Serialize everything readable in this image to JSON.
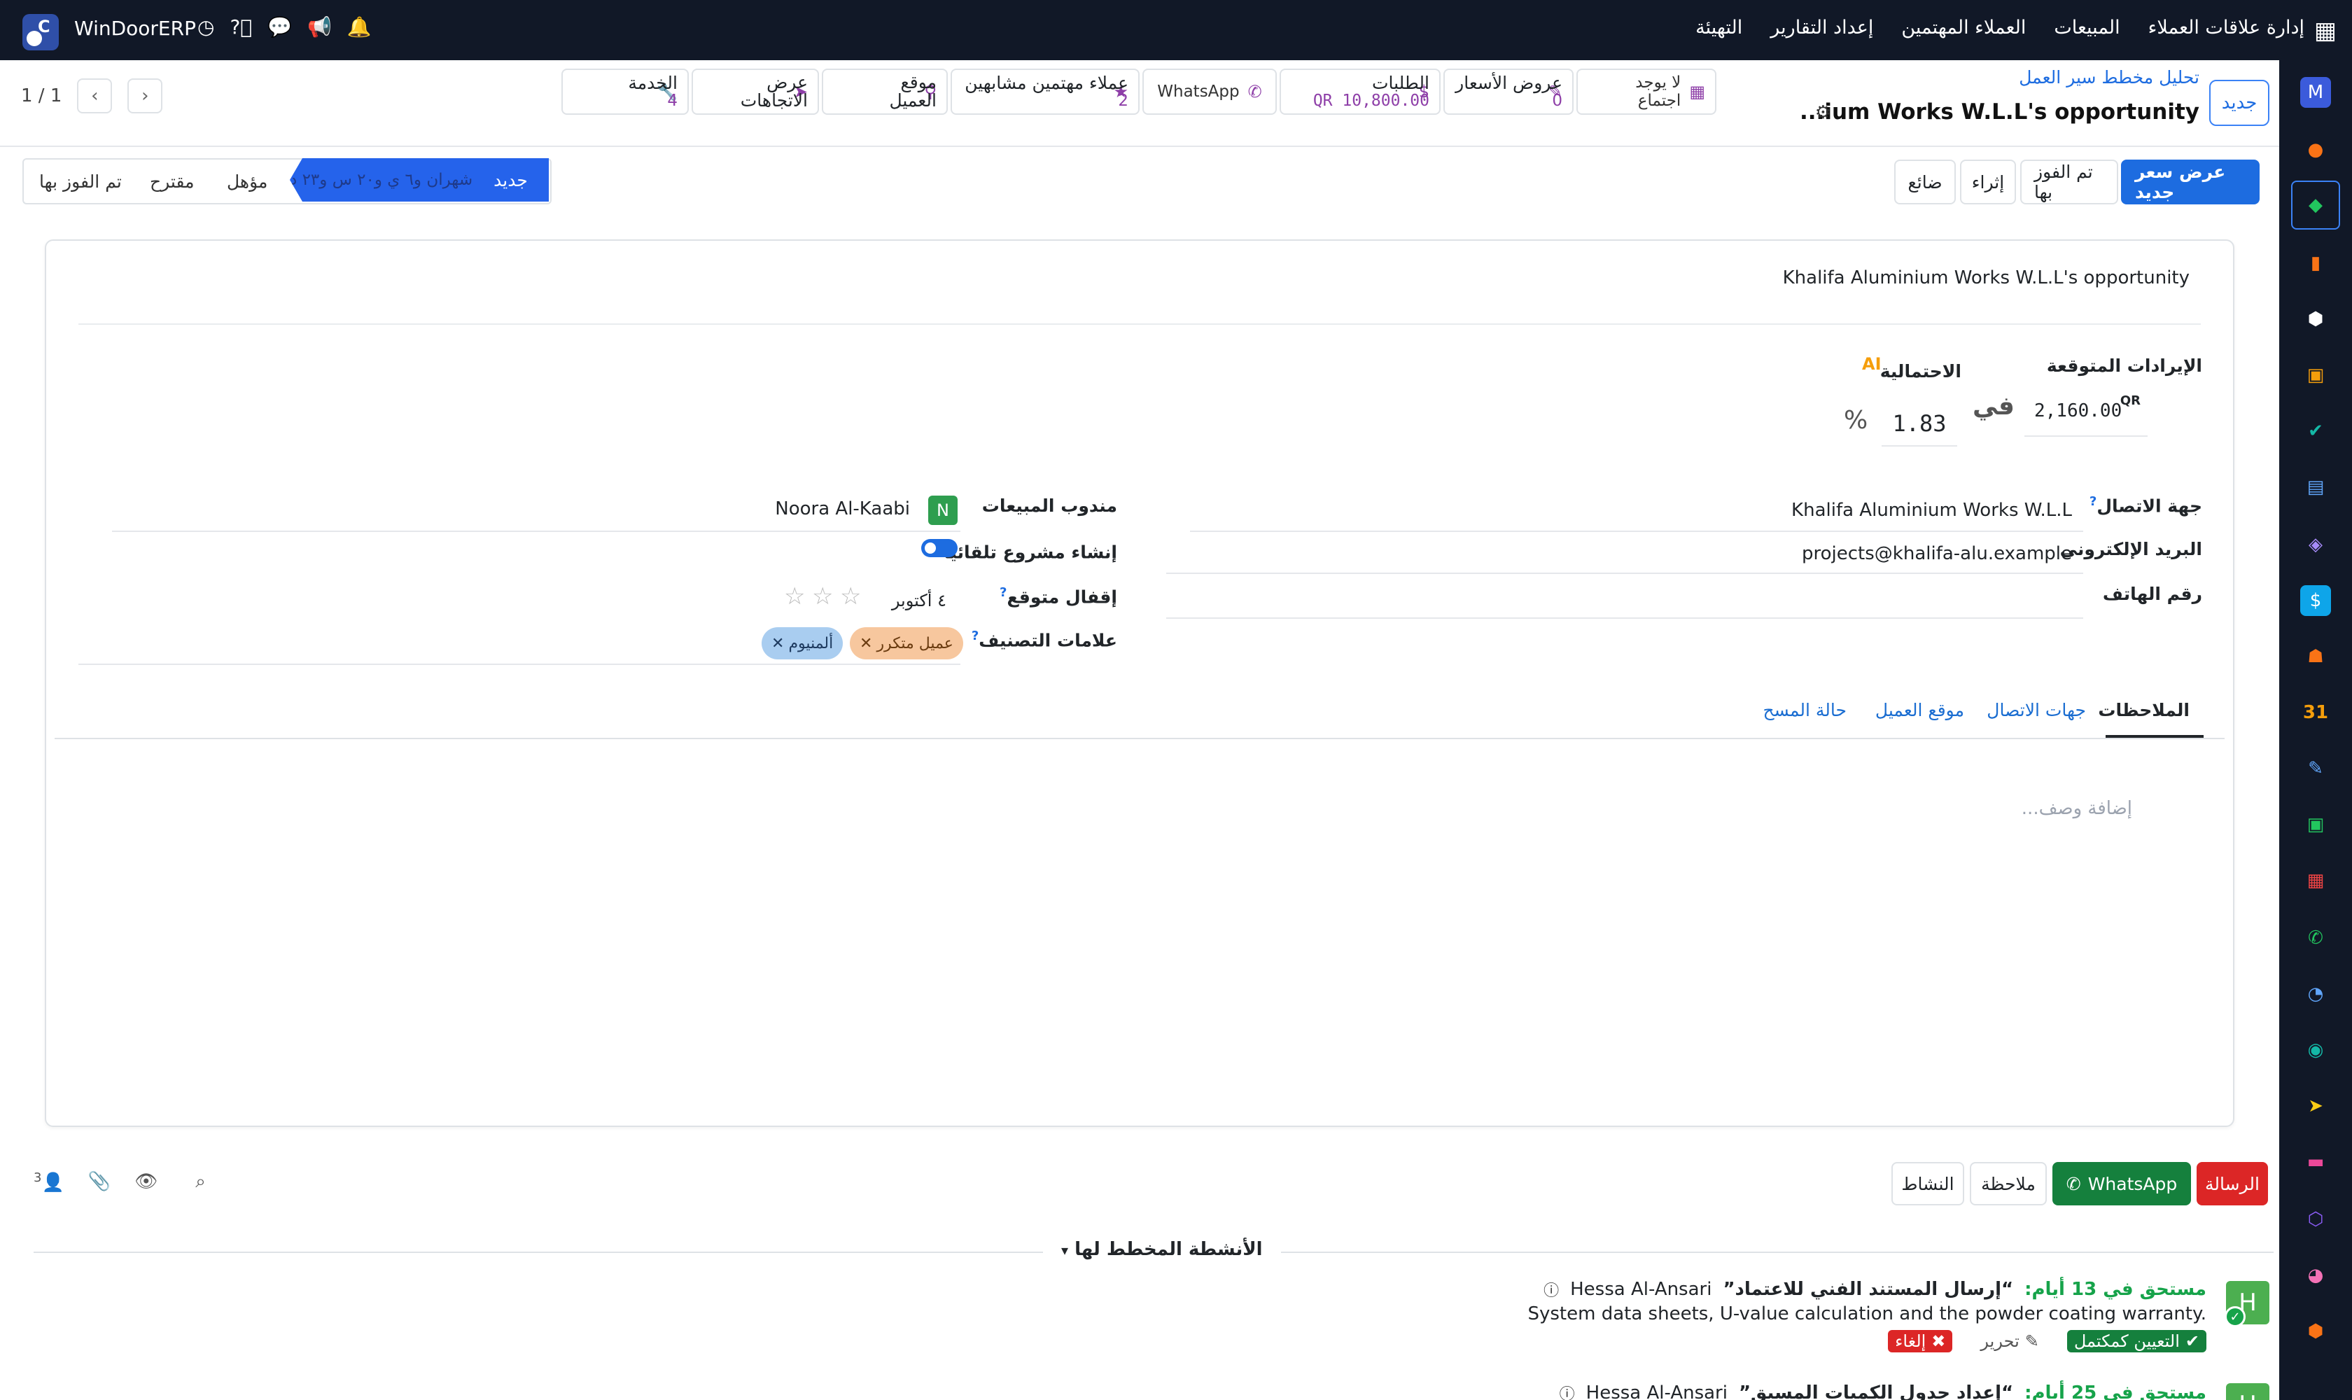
{
  "topbar": {
    "brand": "WinDoorERP",
    "menu": [
      "إدارة علاقات العملاء",
      "المبيعات",
      "العملاء المهتمين",
      "إعداد التقارير",
      "التهيئة"
    ]
  },
  "pager": {
    "text": "1 / 1"
  },
  "breadcrumb": "تحليل مخطط سير العمل",
  "record_title": "...ium Works W.L.L's opportunity",
  "new_label": "جديد",
  "smart_buttons": {
    "meeting": "لا يوجد اجتماع",
    "quotes_label": "عروض الأسعار",
    "quotes_count": "0",
    "orders_label": "الطلبات",
    "orders_amount": "10,800.00 QR",
    "whatsapp": "WhatsApp",
    "similar_label": "عملاء مهتمين مشابهين",
    "similar_count": "2",
    "location_l1": "موقع",
    "location_l2": "العميل",
    "directions_l1": "عرض",
    "directions_l2": "الاتجاهات",
    "service_label": "الخدمة",
    "service_count": "4"
  },
  "actions": {
    "new_quote": "عرض سعر جديد",
    "won": "تم الفوز بها",
    "enrich": "إثراء",
    "lost": "ضائع"
  },
  "stages": {
    "current": "جديد",
    "current_sub": "شهران و٦ ي و٢٠ س و٢٣ د",
    "qualified": "مؤهل",
    "proposition": "مقترح",
    "won": "تم الفوز بها"
  },
  "form": {
    "opportunity_name": "Khalifa Aluminium Works W.L.L's opportunity",
    "expected_revenue_label": "الإيرادات المتوقعة",
    "expected_revenue": "2,160.00",
    "currency": "QR",
    "at_label": "في",
    "probability_label": "الاحتمالية",
    "probability": "1.83",
    "percent": "%",
    "contact_label": "جهة الاتصال",
    "contact_value": "Khalifa Aluminium Works W.L.L",
    "email_label": "البريد الإلكتروني",
    "email_value": "projects@khalifa-alu.example",
    "phone_label": "رقم الهاتف",
    "salesperson_label": "مندوب المبيعات",
    "salesperson_initial": "N",
    "salesperson_value": "Noora Al-Kaabi",
    "auto_project_label": "إنشاء مشروع تلقائياً",
    "expected_close_label": "إقفال متوقع",
    "expected_close_value": "٤ أكتوبر",
    "tags_label": "علامات التصنيف",
    "tags": [
      "عميل متكرر",
      "ألمنيوم"
    ]
  },
  "tabs": [
    "الملاحظات",
    "جهات الاتصال",
    "موقع العميل",
    "حالة المسح"
  ],
  "notes_placeholder": "إضافة وصف...",
  "chatter": {
    "message": "الرسالة",
    "whatsapp": "WhatsApp",
    "note": "ملاحظة",
    "activity": "النشاط",
    "followers_count": "3",
    "planned_title": "الأنشطة المخطط لها"
  },
  "activities": [
    {
      "initial": "H",
      "due": "مستحق في 13 أيام:",
      "title": "“إرسال المستند الفني للاعتماد”",
      "who": "Hessa Al-Ansari",
      "desc": "System data sheets, U-value calculation and the powder coating warranty.",
      "mark_done": "التعيين كمكتمل",
      "edit": "تحرير",
      "cancel": "إلغاء"
    },
    {
      "initial": "H",
      "due": "مستحق في 25 أيام:",
      "title": "“إعداد جدول الكميات المسبق”",
      "who": "Hessa Al-Ansari"
    }
  ],
  "colors": {
    "topbar": "#111827",
    "primary": "#1d6ce0",
    "stage_active": "#2563eb",
    "due": "#16a34a"
  }
}
